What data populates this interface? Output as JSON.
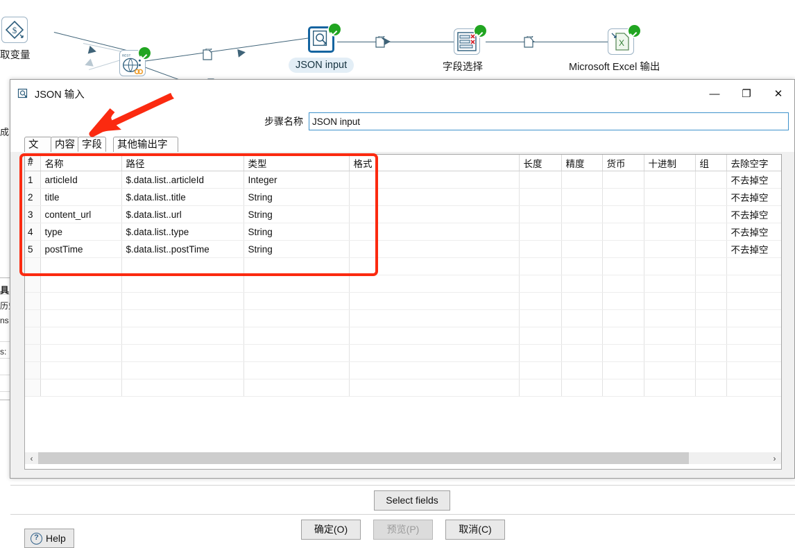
{
  "canvas": {
    "nodes": [
      {
        "name": "get-variables-node",
        "label": "取变量",
        "icon": "diamond-dollar-icon",
        "status": "none"
      },
      {
        "name": "rest-client-node",
        "label": "",
        "icon": "rest-globe-icon",
        "status": "ok"
      },
      {
        "name": "json-input-node",
        "label": "JSON input",
        "icon": "json-input-icon",
        "status": "ok",
        "selected": true
      },
      {
        "name": "select-values-node",
        "label": "字段选择",
        "icon": "select-values-icon",
        "status": "ok"
      },
      {
        "name": "excel-output-node",
        "label": "Microsoft Excel 输出",
        "icon": "excel-output-icon",
        "status": "ok"
      }
    ],
    "background_fragments": [
      "成",
      "具",
      "历史",
      "ns",
      "s:"
    ]
  },
  "dialog": {
    "title": "JSON 输入",
    "title_icon": "json-input-icon",
    "window_controls": {
      "minimize": "—",
      "maximize": "❐",
      "close": "✕"
    },
    "step_name_label": "步骤名称",
    "step_name_value": "JSON input",
    "tabs": [
      {
        "label": "文件",
        "active": false
      },
      {
        "label": "内容",
        "active": false
      },
      {
        "label": "字段",
        "active": true
      },
      {
        "label": "其他输出字段",
        "active": false
      }
    ],
    "table": {
      "columns": [
        "#",
        "名称",
        "路径",
        "类型",
        "格式",
        "长度",
        "精度",
        "货币",
        "十进制",
        "组",
        "去除空字"
      ],
      "rows": [
        {
          "num": "1",
          "name": "articleId",
          "path": "$.data.list..articleId",
          "type": "Integer",
          "format": "",
          "length": "",
          "precision": "",
          "currency": "",
          "decimal": "",
          "group": "",
          "trim": "不去掉空"
        },
        {
          "num": "2",
          "name": "title",
          "path": "$.data.list..title",
          "type": "String",
          "format": "",
          "length": "",
          "precision": "",
          "currency": "",
          "decimal": "",
          "group": "",
          "trim": "不去掉空"
        },
        {
          "num": "3",
          "name": "content_url",
          "path": "$.data.list..url",
          "type": "String",
          "format": "",
          "length": "",
          "precision": "",
          "currency": "",
          "decimal": "",
          "group": "",
          "trim": "不去掉空"
        },
        {
          "num": "4",
          "name": "type",
          "path": "$.data.list..type",
          "type": "String",
          "format": "",
          "length": "",
          "precision": "",
          "currency": "",
          "decimal": "",
          "group": "",
          "trim": "不去掉空"
        },
        {
          "num": "5",
          "name": "postTime",
          "path": "$.data.list..postTime",
          "type": "String",
          "format": "",
          "length": "",
          "precision": "",
          "currency": "",
          "decimal": "",
          "group": "",
          "trim": "不去掉空"
        }
      ],
      "empty_row_count": 8
    },
    "scrollbar": {
      "left_arrow": "‹",
      "right_arrow": "›"
    },
    "buttons": {
      "select_fields": "Select fields",
      "ok": "确定(O)",
      "preview": "预览(P)",
      "cancel": "取消(C)",
      "help": "Help"
    },
    "preview_disabled": true
  },
  "annotation": {
    "accent_color": "#fb2a10",
    "shapes": [
      "highlight-rectangle",
      "pointer-arrow"
    ]
  }
}
